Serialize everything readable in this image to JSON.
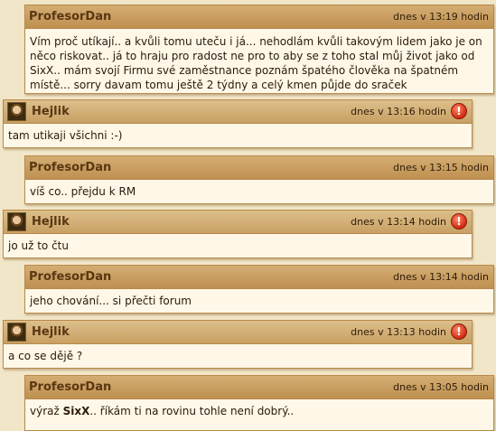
{
  "messages": [
    {
      "author": "ProfesorDan",
      "time": "dnes v 13:19 hodin",
      "text": "Vím proč utíkají.. a kvůli tomu uteču i já... nehodlám kvůli takovým lidem jako je on něco riskovat.. já to hraju pro radost ne pro to aby se z toho stal můj život jako od SixX.. mám svojí Firmu své zaměstnance poznám špatého člověka na špatném místě... sorry davam tomu ještě 2 týdny a celý kmen půjde do sraček"
    },
    {
      "author": "Hejlik",
      "time": "dnes v 13:16 hodin",
      "text": "tam utikaji všichni :-)"
    },
    {
      "author": "ProfesorDan",
      "time": "dnes v 13:15 hodin",
      "text": "víš co.. přejdu k RM"
    },
    {
      "author": "Hejlik",
      "time": "dnes v 13:14 hodin",
      "text": "jo už to čtu"
    },
    {
      "author": "ProfesorDan",
      "time": "dnes v 13:14 hodin",
      "text": "jeho chování... si přečti forum"
    },
    {
      "author": "Hejlik",
      "time": "dnes v 13:13 hodin",
      "text": "a co se dějě ?"
    },
    {
      "author": "ProfesorDan",
      "time": "dnes v 13:05 hodin",
      "text_before": "výraž ",
      "text_bold": "SixX",
      "text_after": ".. říkám ti na rovinu tohle není dobrý.."
    }
  ],
  "report_glyph": "!",
  "icons": {
    "avatar": "user-avatar-icon",
    "report": "report-alert-icon"
  }
}
